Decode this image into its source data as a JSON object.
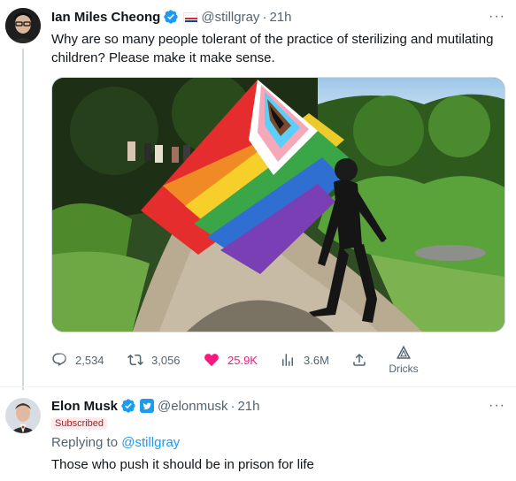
{
  "tweet1": {
    "name": "Ian Miles Cheong",
    "handle": "@stillgray",
    "dot": "·",
    "time": "21h",
    "text": "Why are so many people tolerant of the practice of sterilizing and mutilating children? Please make it make sense.",
    "more": "···",
    "image_alt": "Person walking on a dirt trail carrying a progress pride flag",
    "actions": {
      "replies": "2,534",
      "retweets": "3,056",
      "likes": "25.9K",
      "views": "3.6M",
      "share": "",
      "dricks": "Dricks"
    }
  },
  "tweet2": {
    "name": "Elon Musk",
    "handle": "@elonmusk",
    "dot": "·",
    "time": "21h",
    "subscribed": "Subscribed",
    "replying_prefix": "Replying to",
    "replying_handle": "@stillgray",
    "text": "Those who push it should be in prison for life",
    "more": "···"
  },
  "colors": {
    "verified_blue": "#1d9bf0",
    "like_pink": "#f91880",
    "secondary_text": "#536471"
  }
}
